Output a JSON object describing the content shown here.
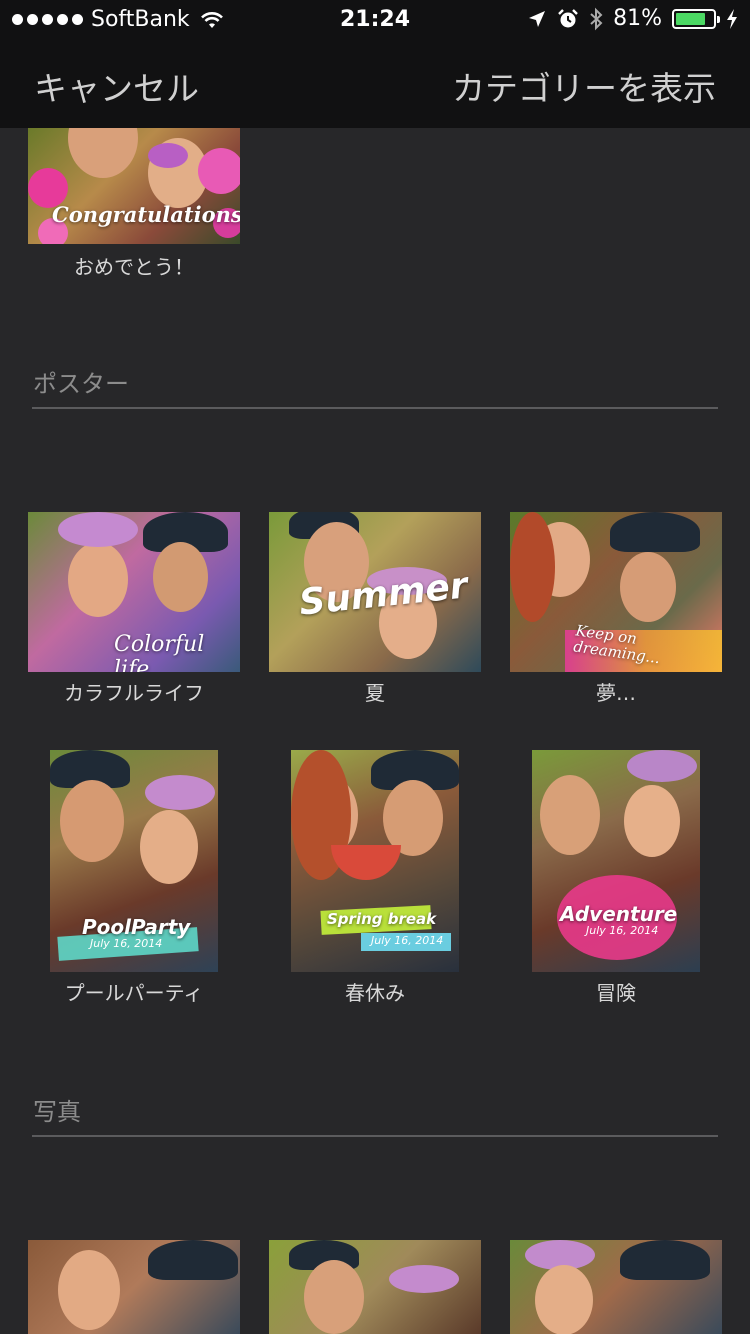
{
  "status_bar": {
    "carrier": "SoftBank",
    "time": "21:24",
    "battery_percent": "81%",
    "battery_level": 0.81
  },
  "nav": {
    "cancel_label": "キャンセル",
    "show_categories_label": "カテゴリーを表示"
  },
  "sections": {
    "poster_title": "ポスター",
    "photo_title": "写真"
  },
  "top_item": {
    "label": "おめでとう！",
    "caption": "Congratulations!"
  },
  "poster_items": [
    {
      "label": "カラフルライフ",
      "caption": "Colorful life"
    },
    {
      "label": "夏",
      "caption": "Summer"
    },
    {
      "label": "夢…",
      "caption": "Keep on dreaming..."
    },
    {
      "label": "プールパーティ",
      "caption": "PoolParty",
      "sub": "July 16, 2014"
    },
    {
      "label": "春休み",
      "caption": "Spring break",
      "sub": "July 16, 2014"
    },
    {
      "label": "冒険",
      "caption": "Adventure",
      "sub": "July 16, 2014"
    }
  ],
  "colors": {
    "background": "#272729",
    "bar": "#111112",
    "battery": "#4cd964"
  }
}
